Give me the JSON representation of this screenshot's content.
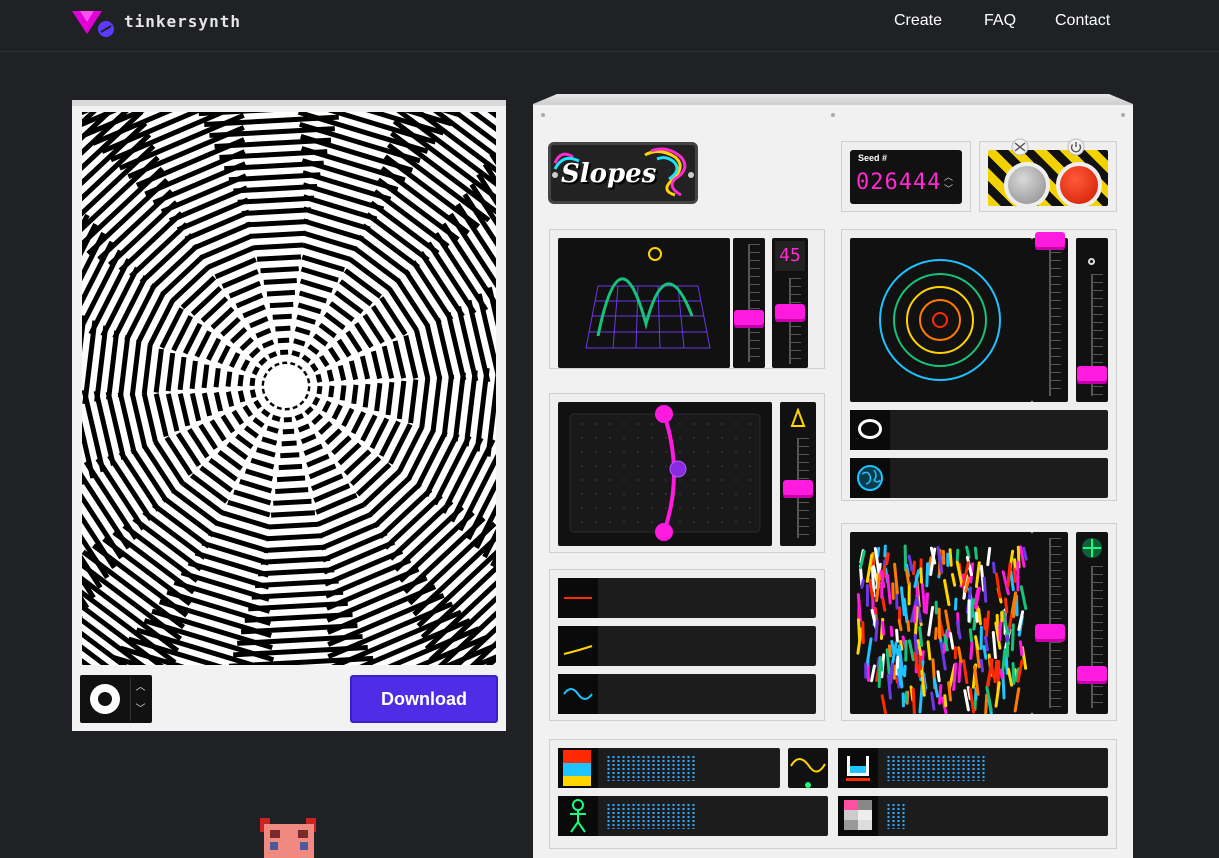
{
  "header": {
    "brand": "tinkersynth",
    "nav": [
      {
        "label": "Create"
      },
      {
        "label": "FAQ"
      },
      {
        "label": "Contact"
      }
    ]
  },
  "preview": {
    "download_label": "Download"
  },
  "machine": {
    "title": "Slopes",
    "seed_label": "Seed #",
    "seed_value": "026444",
    "peaks_value": "45"
  },
  "colors": {
    "accent": "#ff1ae0",
    "download": "#4d2ee6",
    "seed_digits": "#ff2ad1",
    "background": "#1f2124"
  },
  "icons": {
    "randomize": "shuffle-icon",
    "power": "power-icon"
  }
}
